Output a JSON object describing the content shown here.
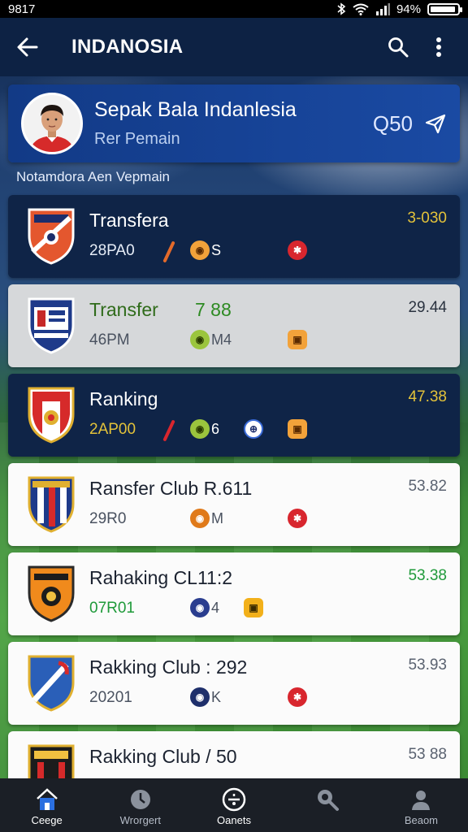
{
  "status_bar": {
    "time": "9817",
    "battery": "94%"
  },
  "app_bar": {
    "title": "INDANOSIA"
  },
  "profile": {
    "name": "Sepak Bala Indanlesia",
    "subtitle": "Rer Pemain",
    "score": "Q50"
  },
  "section_label": "Notamdora  Aen Vepmain",
  "rows": [
    {
      "name": "Transfera",
      "sub": "28PA0",
      "chip1": "S",
      "value": "3-030",
      "style": "dark",
      "value_color": "#e3c23a"
    },
    {
      "name": "Transfer",
      "extra": "7  88",
      "sub": "46PM",
      "chip1": "M4",
      "value": "29.44",
      "style": "grey",
      "value_color": "#2b3340"
    },
    {
      "name": "Ranking",
      "sub": "2AP00",
      "chip1": "6",
      "value": "47.38",
      "style": "dark",
      "value_color": "#e3c23a"
    },
    {
      "name": "Ransfer Club  R.611",
      "sub": "29R0",
      "chip1": "M",
      "value": "53.82",
      "style": "light",
      "value_color": "#5a6270"
    },
    {
      "name": "Rahaking CL11:2",
      "sub": "07R01",
      "chip1": "4",
      "value": "53.38",
      "style": "light",
      "value_color": "#1f9a3a"
    },
    {
      "name": "Rakking Club : 292",
      "sub": "20201",
      "chip1": "K",
      "value": "53.93",
      "style": "light",
      "value_color": "#5a6270"
    },
    {
      "name": "Rakking Club / 50",
      "sub": "",
      "chip1": "",
      "value": "53 88",
      "style": "light",
      "value_color": "#5a6270"
    }
  ],
  "nav": [
    {
      "label": "Ceege",
      "icon": "home-icon"
    },
    {
      "label": "Wrorgert",
      "icon": "clock-icon"
    },
    {
      "label": "Oanets",
      "icon": "ball-icon"
    },
    {
      "label": "",
      "icon": "search-chat-icon"
    },
    {
      "label": "Beaom",
      "icon": "profile-icon"
    }
  ],
  "colors": {
    "accent": "#1a4aa3",
    "dark_row": "#0f2447",
    "gold": "#e3c23a",
    "green": "#1f9a3a",
    "red": "#d8262e"
  }
}
